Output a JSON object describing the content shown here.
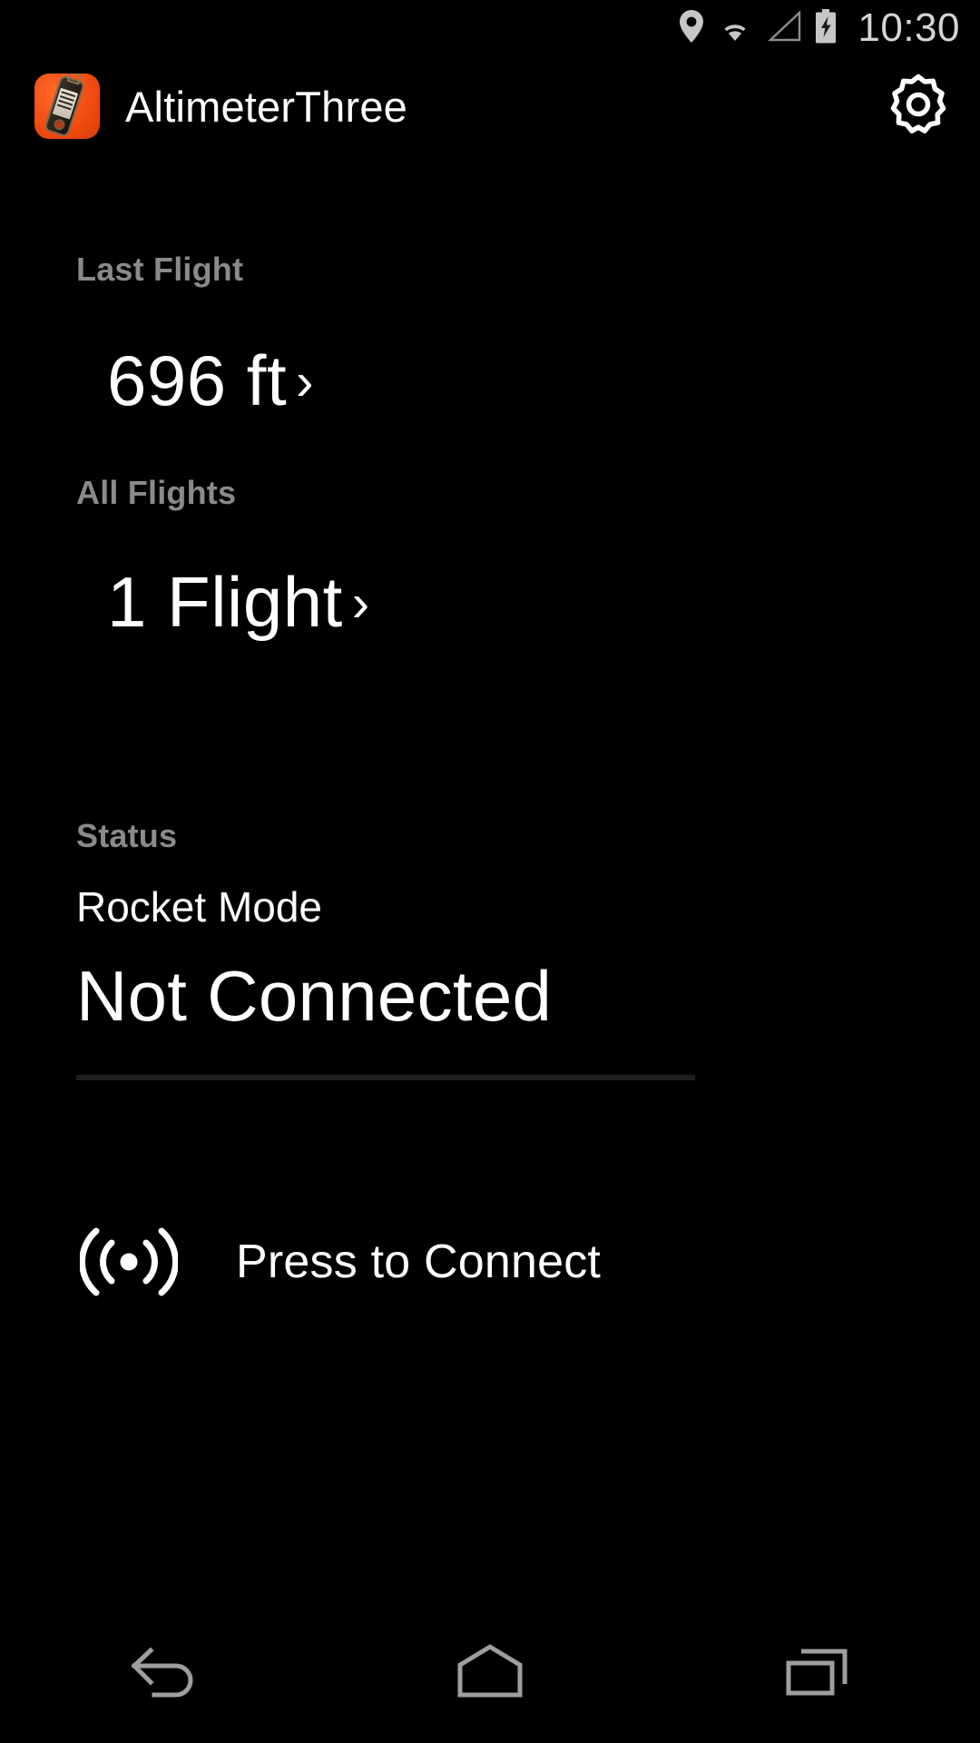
{
  "status_bar": {
    "icons": [
      "location-pin-icon",
      "wifi-icon",
      "cell-signal-icon",
      "battery-charging-icon"
    ],
    "clock": "10:30"
  },
  "app_bar": {
    "icon_name": "altimeterthree-app-icon",
    "title": "AltimeterThree",
    "settings_icon": "gear-icon",
    "brand_color": "#f24d12"
  },
  "sections": {
    "last_flight": {
      "label": "Last Flight",
      "value": "696 ft",
      "chevron": "›"
    },
    "all_flights": {
      "label": "All Flights",
      "value": "1 Flight",
      "chevron": "›"
    },
    "status": {
      "label": "Status",
      "mode": "Rocket Mode",
      "connection": "Not Connected",
      "divider_color": "#1e1e1e"
    }
  },
  "connect": {
    "icon_name": "broadcast-icon",
    "label": "Press to Connect"
  },
  "nav_bar": {
    "back": "back-icon",
    "home": "home-icon",
    "recents": "recents-icon"
  },
  "colors": {
    "background": "#000000",
    "primary_text": "#ffffff",
    "secondary_text": "#8a8a8a",
    "status_icon": "#c6c6c6",
    "nav_icon": "#9e9e9e"
  }
}
